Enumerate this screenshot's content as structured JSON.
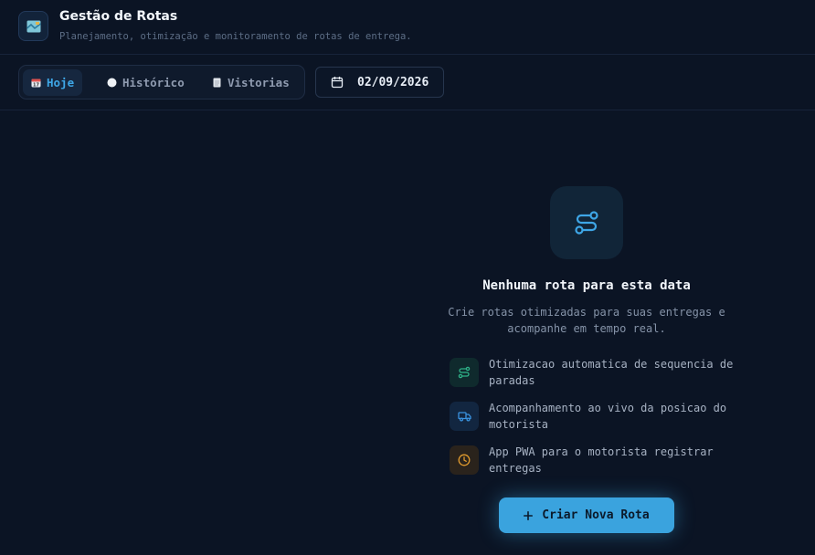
{
  "header": {
    "title": "Gestão de Rotas",
    "subtitle": "Planejamento, otimização e monitoramento de rotas de entrega."
  },
  "tabs": [
    {
      "label": "Hoje",
      "icon": "calendar-icon",
      "active": true
    },
    {
      "label": "Histórico",
      "icon": "circle-icon",
      "active": false
    },
    {
      "label": "Vistorias",
      "icon": "clipboard-icon",
      "active": false
    }
  ],
  "date_picker": {
    "value": "02/09/2026",
    "icon": "calendar-icon"
  },
  "empty_state": {
    "icon": "route-icon",
    "title": "Nenhuma rota para esta data",
    "description": "Crie rotas otimizadas para suas entregas e acompanhe em tempo real.",
    "features": [
      {
        "text": "Otimizacao automatica de sequencia de paradas",
        "icon": "route-icon",
        "color": "#2fb389"
      },
      {
        "text": "Acompanhamento ao vivo da posicao do motorista",
        "icon": "truck-icon",
        "color": "#3a93e0"
      },
      {
        "text": "App PWA para o motorista registrar entregas",
        "icon": "clock-icon",
        "color": "#e09a2e"
      }
    ],
    "cta_label": "Criar Nova Rota",
    "cta_icon": "plus-icon"
  },
  "colors": {
    "background": "#0b1424",
    "accent": "#3aa3de",
    "text": "#e6edf5"
  }
}
